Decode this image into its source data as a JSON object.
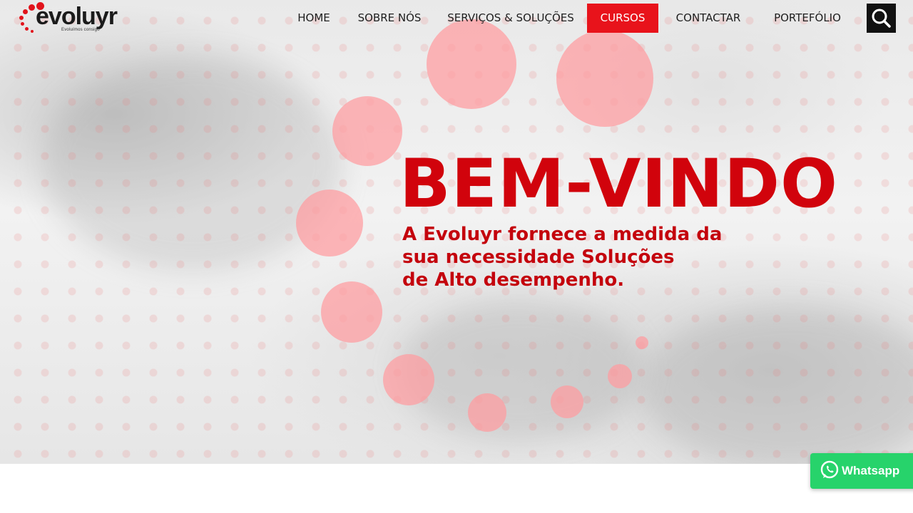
{
  "brand": {
    "name": "evoluyr",
    "tagline": "Evoluímos consigo",
    "accent_color": "#e8131b",
    "title_color": "#d1030c"
  },
  "nav": {
    "items": [
      {
        "label": "HOME",
        "active": false
      },
      {
        "label": "SOBRE NÓS",
        "active": false
      },
      {
        "label": "SERVIÇOS & SOLUÇÕES",
        "active": false
      },
      {
        "label": "CURSOS",
        "active": true
      },
      {
        "label": "CONTACTAR",
        "active": false
      },
      {
        "label": "PORTEFÓLIO",
        "active": false
      }
    ],
    "search_icon": "search-icon"
  },
  "hero": {
    "title": "BEM-VINDO",
    "subtitle_lines": [
      "A Evoluyr fornece a medida da",
      "sua necessidade Soluções",
      "de Alto desempenho."
    ]
  },
  "whatsapp": {
    "label": "Whatsapp",
    "icon": "whatsapp-icon",
    "color": "#27d36b"
  }
}
